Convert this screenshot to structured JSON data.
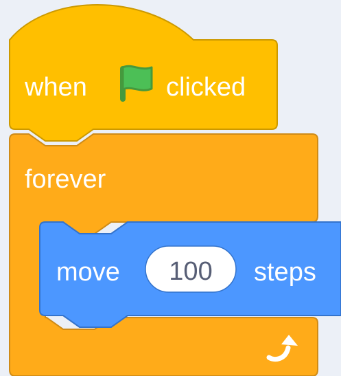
{
  "hat_block": {
    "label_before": "when",
    "label_after": "clicked",
    "flag_icon": "green-flag-icon",
    "color": "#FFBF00",
    "border_color": "#CC9900"
  },
  "forever_block": {
    "label": "forever",
    "loop_icon": "loop-arrow-icon",
    "color": "#FFAB19",
    "border_color": "#CF8B17"
  },
  "motion_block": {
    "label_before": "move",
    "input_value": "100",
    "label_after": "steps",
    "color": "#4C97FF",
    "border_color": "#3373CC"
  },
  "flag_color": "#4CBF56",
  "flag_border": "#45993D"
}
